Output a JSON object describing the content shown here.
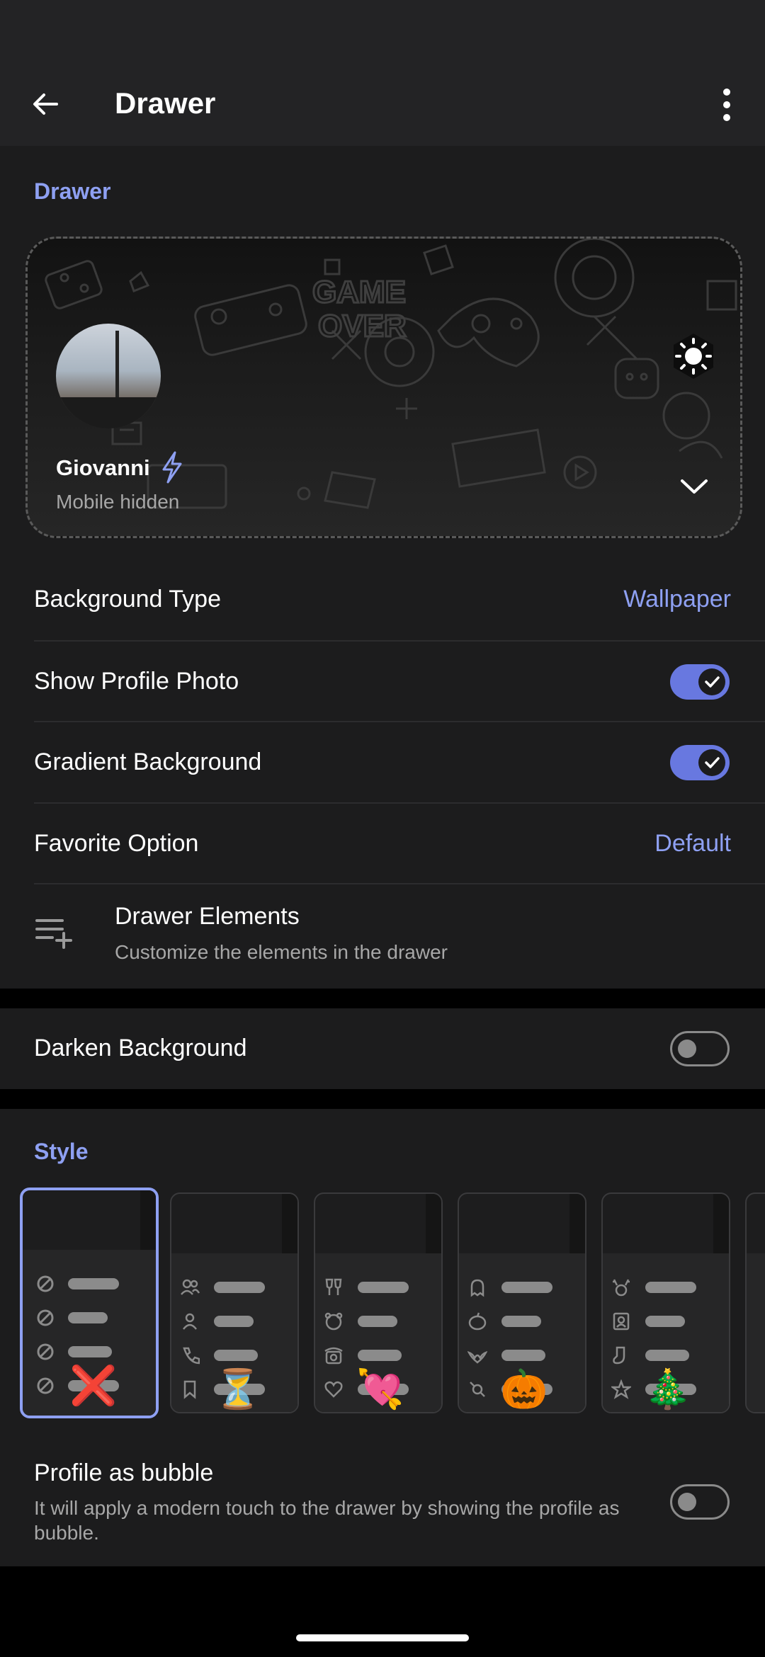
{
  "appbar": {
    "title": "Drawer"
  },
  "drawer_section": {
    "title": "Drawer"
  },
  "preview": {
    "name": "Giovanni",
    "subtitle": "Mobile hidden"
  },
  "settings": [
    {
      "label": "Background Type",
      "value": "Wallpaper"
    },
    {
      "label": "Show Profile Photo",
      "toggle": true
    },
    {
      "label": "Gradient Background",
      "toggle": true
    },
    {
      "label": "Favorite Option",
      "value": "Default"
    }
  ],
  "drawer_elements": {
    "title": "Drawer Elements",
    "subtitle": "Customize the elements in the drawer"
  },
  "darken": {
    "label": "Darken Background",
    "toggle": false
  },
  "style_section": {
    "title": "Style",
    "items": [
      {
        "emoji": "❌",
        "selected": true
      },
      {
        "emoji": "⏳",
        "selected": false
      },
      {
        "emoji": "💘",
        "selected": false
      },
      {
        "emoji": "🎃",
        "selected": false
      },
      {
        "emoji": "🎄",
        "selected": false
      }
    ]
  },
  "bubble": {
    "title": "Profile as bubble",
    "subtitle": "It will apply a modern touch to the drawer by showing the profile as bubble.",
    "toggle": false
  },
  "colors": {
    "accent": "#8ea0f2",
    "toggle_on": "#6878e0",
    "surface": "#1c1c1d",
    "appbar": "#232325"
  }
}
